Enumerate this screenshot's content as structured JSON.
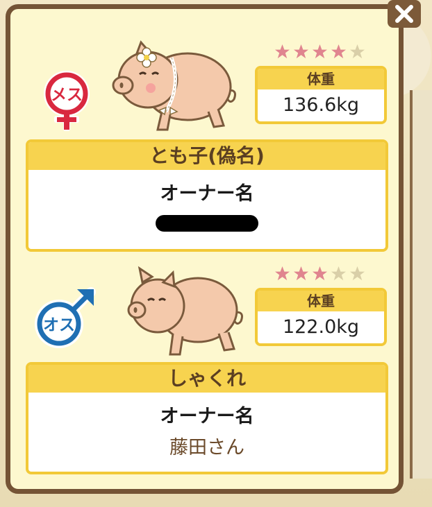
{
  "dialog": {
    "close_label": "×"
  },
  "pigs": [
    {
      "gender": "メス",
      "gender_icon": "female-symbol-icon",
      "stars_filled": 4,
      "stars_total": 5,
      "weight_label": "体重",
      "weight_value": "136.6kg",
      "name": "とも子(偽名)",
      "owner_label": "オーナー名",
      "owner_name": ""
    },
    {
      "gender": "オス",
      "gender_icon": "male-symbol-icon",
      "stars_filled": 3,
      "stars_total": 5,
      "weight_label": "体重",
      "weight_value": "122.0kg",
      "name": "しゃくれ",
      "owner_label": "オーナー名",
      "owner_name": "藤田さん"
    }
  ],
  "colors": {
    "frame": "#745335",
    "panel": "#fdf8cf",
    "header_yellow": "#f7d34f",
    "star_filled": "#e0858f",
    "star_empty": "#d9cfa8",
    "female": "#d9283f",
    "male": "#1f6fb3"
  }
}
